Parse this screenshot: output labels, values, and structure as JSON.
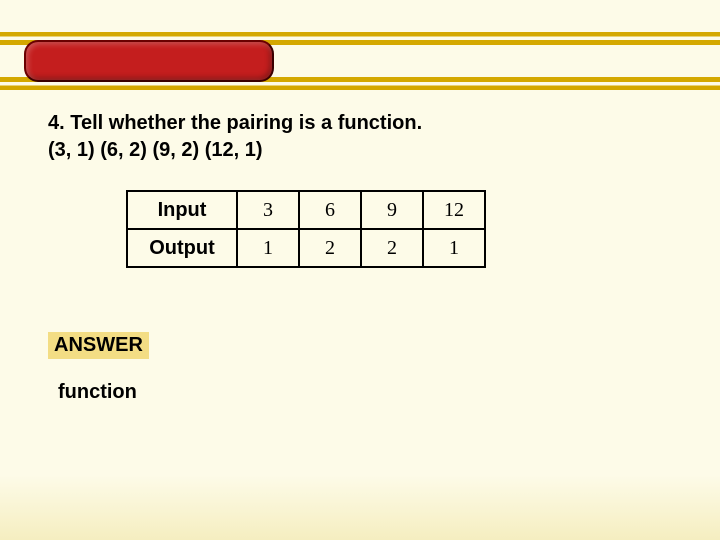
{
  "question": {
    "prompt": "4. Tell whether the pairing is a function.",
    "pairs_text": "(3, 1) (6, 2) (9, 2) (12, 1)"
  },
  "table": {
    "input_label": "Input",
    "output_label": "Output",
    "inputs": [
      "3",
      "6",
      "9",
      "12"
    ],
    "outputs": [
      "1",
      "2",
      "2",
      "1"
    ]
  },
  "answer": {
    "label": "ANSWER",
    "text": "function"
  },
  "chart_data": {
    "type": "table",
    "rows": [
      {
        "label": "Input",
        "values": [
          3,
          6,
          9,
          12
        ]
      },
      {
        "label": "Output",
        "values": [
          1,
          2,
          2,
          1
        ]
      }
    ]
  }
}
